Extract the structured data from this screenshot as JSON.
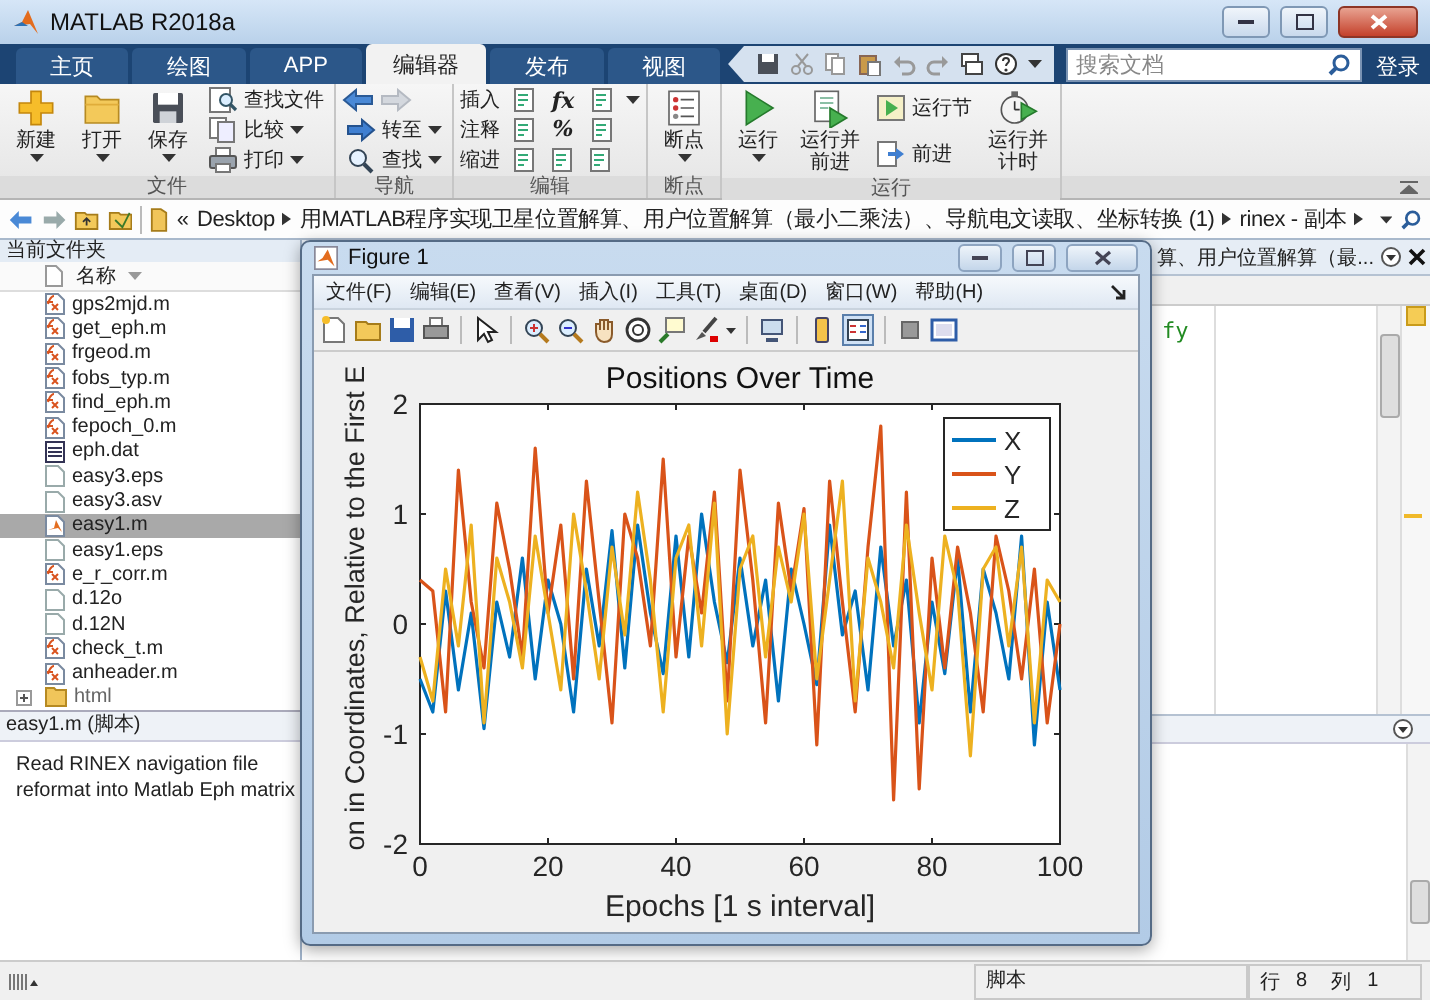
{
  "window": {
    "title": "MATLAB R2018a"
  },
  "tabs": [
    {
      "label": "主页",
      "selected": false
    },
    {
      "label": "绘图",
      "selected": false
    },
    {
      "label": "APP",
      "selected": false
    },
    {
      "label": "编辑器",
      "selected": true
    },
    {
      "label": "发布",
      "selected": false
    },
    {
      "label": "视图",
      "selected": false
    }
  ],
  "search": {
    "placeholder": "搜索文档"
  },
  "sign_in": "登录",
  "ribbon": [
    {
      "label": "文件",
      "items": [
        {
          "kind": "large",
          "label": "新建",
          "dropdown": true
        },
        {
          "kind": "large",
          "label": "打开",
          "dropdown": true
        },
        {
          "kind": "large",
          "label": "保存",
          "dropdown": true
        },
        {
          "kind": "small",
          "label": "查找文件",
          "dropdown": false
        },
        {
          "kind": "small",
          "label": "比较",
          "dropdown": true
        },
        {
          "kind": "small",
          "label": "打印",
          "dropdown": true
        }
      ]
    },
    {
      "label": "导航",
      "items": [
        {
          "kind": "history",
          "forward_disabled": true
        },
        {
          "kind": "small",
          "label": "转至",
          "dropdown": true
        },
        {
          "kind": "small",
          "label": "查找",
          "dropdown": true
        }
      ]
    },
    {
      "label": "编辑",
      "items": [
        {
          "kind": "row",
          "label": "插入",
          "glyph": "fx",
          "dropdown": true
        },
        {
          "kind": "row",
          "label": "注释",
          "glyph": "%",
          "dropdown": false
        },
        {
          "kind": "row",
          "label": "缩进",
          "dropdown": false
        }
      ]
    },
    {
      "label": "断点",
      "items": [
        {
          "kind": "large",
          "label": "断点",
          "dropdown": true
        }
      ]
    },
    {
      "label": "运行",
      "items": [
        {
          "kind": "large",
          "label": "运行",
          "dropdown": true
        },
        {
          "kind": "large",
          "label": "运行并前进",
          "dropdown": false
        },
        {
          "kind": "small",
          "label": "运行节",
          "dropdown": false
        },
        {
          "kind": "small",
          "label": "前进",
          "dropdown": false
        },
        {
          "kind": "large",
          "label": "运行并计时",
          "dropdown": false
        }
      ]
    }
  ],
  "address_bar": {
    "overflow": "«",
    "path": [
      "Desktop",
      "用MATLAB程序实现卫星位置解算、用户位置解算（最小二乘法）、导航电文读取、坐标转换 (1)",
      "rinex - 副本"
    ]
  },
  "current_folder": {
    "title": "当前文件夹",
    "column": "名称",
    "files": [
      {
        "name": "gps2mjd.m",
        "kind": "function",
        "selected": false
      },
      {
        "name": "get_eph.m",
        "kind": "function",
        "selected": false
      },
      {
        "name": "frgeod.m",
        "kind": "function",
        "selected": false
      },
      {
        "name": "fobs_typ.m",
        "kind": "function",
        "selected": false
      },
      {
        "name": "find_eph.m",
        "kind": "function",
        "selected": false
      },
      {
        "name": "fepoch_0.m",
        "kind": "function",
        "selected": false
      },
      {
        "name": "eph.dat",
        "kind": "data",
        "selected": false
      },
      {
        "name": "easy3.eps",
        "kind": "file",
        "selected": false
      },
      {
        "name": "easy3.asv",
        "kind": "file",
        "selected": false
      },
      {
        "name": "easy1.m",
        "kind": "script",
        "selected": true
      },
      {
        "name": "easy1.eps",
        "kind": "file",
        "selected": false
      },
      {
        "name": "e_r_corr.m",
        "kind": "function",
        "selected": false
      },
      {
        "name": "d.12o",
        "kind": "file",
        "selected": false
      },
      {
        "name": "d.12N",
        "kind": "file",
        "selected": false
      },
      {
        "name": "check_t.m",
        "kind": "function",
        "selected": false
      },
      {
        "name": "anheader.m",
        "kind": "function",
        "selected": false
      },
      {
        "name": "html",
        "kind": "folder",
        "selected": false
      }
    ]
  },
  "details": {
    "title": "easy1.m  (脚本)",
    "lines": [
      "Read RINEX navigation file",
      "reformat into Matlab Eph matrix"
    ]
  },
  "editor": {
    "title": "算、用户位置解算（最...",
    "code_fragment": "fy"
  },
  "figure": {
    "title": "Figure 1",
    "menu": [
      "文件(F)",
      "编辑(E)",
      "查看(V)",
      "插入(I)",
      "工具(T)",
      "桌面(D)",
      "窗口(W)",
      "帮助(H)"
    ],
    "legend_toggle_on": true,
    "chart_data": {
      "type": "line",
      "title": "Positions Over Time",
      "xlabel": "Epochs [1 s interval]",
      "ylabel": "on in Coordinates, Relative to the First E",
      "x": [
        0,
        2,
        4,
        6,
        8,
        10,
        12,
        14,
        16,
        18,
        20,
        22,
        24,
        26,
        28,
        30,
        32,
        34,
        36,
        38,
        40,
        42,
        44,
        46,
        48,
        50,
        52,
        54,
        56,
        58,
        60,
        62,
        64,
        66,
        68,
        70,
        72,
        74,
        76,
        78,
        80,
        82,
        84,
        86,
        88,
        90,
        92,
        94,
        96,
        98,
        100
      ],
      "series": [
        {
          "name": "X",
          "color": "#0072bd",
          "values": [
            -0.5,
            -0.8,
            0.3,
            -0.6,
            0.1,
            -0.95,
            0.2,
            -0.3,
            0.6,
            -0.5,
            0.4,
            0.0,
            -0.8,
            0.5,
            -0.2,
            0.85,
            -0.4,
            0.9,
            0.1,
            -0.45,
            0.8,
            -0.3,
            1.0,
            0.2,
            -0.35,
            0.6,
            -0.2,
            0.4,
            -0.7,
            0.5,
            0.0,
            -0.55,
            0.9,
            -0.1,
            0.3,
            -0.6,
            0.7,
            -0.2,
            0.4,
            -0.9,
            0.2,
            -0.45,
            0.6,
            -0.8,
            0.5,
            0.1,
            -0.5,
            0.8,
            -1.1,
            0.2,
            -0.6
          ]
        },
        {
          "name": "Y",
          "color": "#d95319",
          "values": [
            0.4,
            0.3,
            -0.8,
            1.4,
            0.2,
            -0.4,
            1.1,
            0.5,
            -0.3,
            1.6,
            0.1,
            0.9,
            -0.5,
            1.3,
            0.2,
            -0.9,
            1.0,
            0.6,
            -0.2,
            1.5,
            -0.3,
            0.8,
            0.1,
            1.2,
            -0.7,
            1.4,
            0.4,
            -0.9,
            1.1,
            0.3,
            1.05,
            -1.1,
            1.3,
            0.2,
            -0.8,
            0.7,
            1.8,
            -1.6,
            1.2,
            -1.5,
            0.6,
            -0.4,
            0.7,
            0.1,
            -0.8,
            0.8,
            0.3,
            -0.5,
            0.5,
            -0.9,
            0.0
          ]
        },
        {
          "name": "Z",
          "color": "#edb120",
          "values": [
            -0.3,
            -0.7,
            0.5,
            -0.2,
            0.9,
            -0.9,
            0.6,
            0.2,
            -0.4,
            0.8,
            0.1,
            -0.6,
            1.0,
            0.3,
            -0.5,
            0.7,
            -0.1,
            1.2,
            0.4,
            -0.8,
            0.6,
            0.9,
            -0.2,
            1.1,
            -1.0,
            0.5,
            0.8,
            -0.3,
            0.7,
            0.2,
            1.0,
            -0.5,
            0.4,
            1.3,
            -0.7,
            0.6,
            0.2,
            -0.4,
            0.9,
            0.1,
            -0.6,
            0.8,
            0.3,
            -1.2,
            0.5,
            0.7,
            -0.2,
            0.7,
            -0.9,
            0.4,
            0.2
          ]
        }
      ],
      "legend": "upper right",
      "xlim": [
        0,
        100
      ],
      "ylim": [
        -2,
        2
      ],
      "xticks": [
        0,
        20,
        40,
        60,
        80,
        100
      ],
      "yticks": [
        -2,
        -1,
        0,
        1,
        2
      ]
    }
  },
  "status_bar": {
    "mode": "脚本",
    "row_label": "行",
    "row": "8",
    "col_label": "列",
    "col": "1"
  }
}
